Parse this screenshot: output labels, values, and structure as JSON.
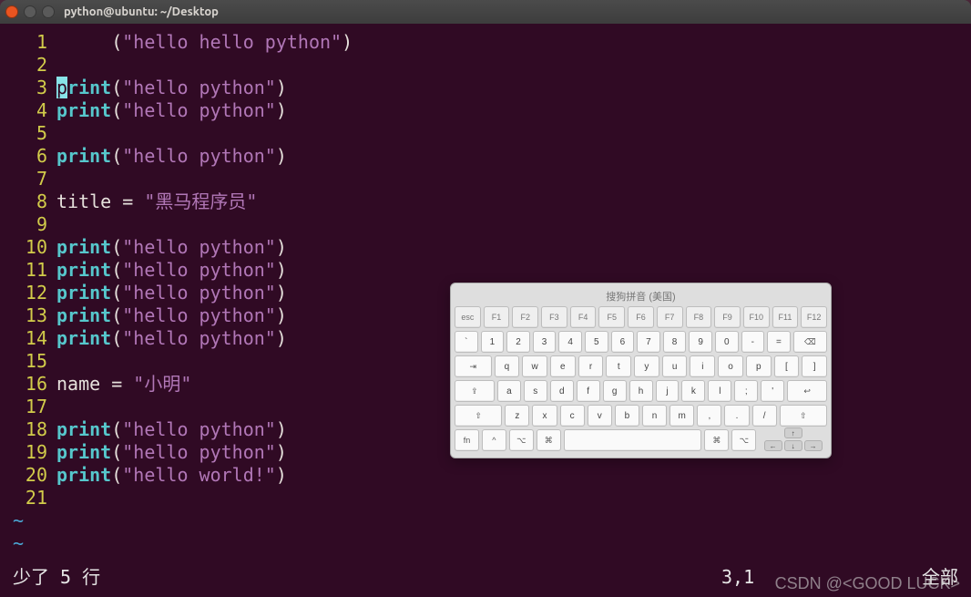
{
  "window": {
    "title": "python@ubuntu: ~/Desktop"
  },
  "cursor": {
    "row": 3,
    "col": 1,
    "char": "p"
  },
  "code_lines": [
    {
      "n": 1,
      "tokens": [
        {
          "t": "plain",
          "v": "     ("
        },
        {
          "t": "str",
          "v": "\"hello hello python\""
        },
        {
          "t": "plain",
          "v": ")"
        }
      ]
    },
    {
      "n": 2,
      "tokens": []
    },
    {
      "n": 3,
      "tokens": [
        {
          "t": "cursor",
          "v": "p"
        },
        {
          "t": "kw",
          "v": "rint"
        },
        {
          "t": "plain",
          "v": "("
        },
        {
          "t": "str",
          "v": "\"hello python\""
        },
        {
          "t": "plain",
          "v": ")"
        }
      ]
    },
    {
      "n": 4,
      "tokens": [
        {
          "t": "kw",
          "v": "print"
        },
        {
          "t": "plain",
          "v": "("
        },
        {
          "t": "str",
          "v": "\"hello python\""
        },
        {
          "t": "plain",
          "v": ")"
        }
      ]
    },
    {
      "n": 5,
      "tokens": []
    },
    {
      "n": 6,
      "tokens": [
        {
          "t": "kw",
          "v": "print"
        },
        {
          "t": "plain",
          "v": "("
        },
        {
          "t": "str",
          "v": "\"hello python\""
        },
        {
          "t": "plain",
          "v": ")"
        }
      ]
    },
    {
      "n": 7,
      "tokens": []
    },
    {
      "n": 8,
      "tokens": [
        {
          "t": "plain",
          "v": "title = "
        },
        {
          "t": "str",
          "v": "\"黑马程序员\""
        }
      ]
    },
    {
      "n": 9,
      "tokens": []
    },
    {
      "n": 10,
      "tokens": [
        {
          "t": "kw",
          "v": "print"
        },
        {
          "t": "plain",
          "v": "("
        },
        {
          "t": "str",
          "v": "\"hello python\""
        },
        {
          "t": "plain",
          "v": ")"
        }
      ]
    },
    {
      "n": 11,
      "tokens": [
        {
          "t": "kw",
          "v": "print"
        },
        {
          "t": "plain",
          "v": "("
        },
        {
          "t": "str",
          "v": "\"hello python\""
        },
        {
          "t": "plain",
          "v": ")"
        }
      ]
    },
    {
      "n": 12,
      "tokens": [
        {
          "t": "kw",
          "v": "print"
        },
        {
          "t": "plain",
          "v": "("
        },
        {
          "t": "str",
          "v": "\"hello python\""
        },
        {
          "t": "plain",
          "v": ")"
        }
      ]
    },
    {
      "n": 13,
      "tokens": [
        {
          "t": "kw",
          "v": "print"
        },
        {
          "t": "plain",
          "v": "("
        },
        {
          "t": "str",
          "v": "\"hello python\""
        },
        {
          "t": "plain",
          "v": ")"
        }
      ]
    },
    {
      "n": 14,
      "tokens": [
        {
          "t": "kw",
          "v": "print"
        },
        {
          "t": "plain",
          "v": "("
        },
        {
          "t": "str",
          "v": "\"hello python\""
        },
        {
          "t": "plain",
          "v": ")"
        }
      ]
    },
    {
      "n": 15,
      "tokens": []
    },
    {
      "n": 16,
      "tokens": [
        {
          "t": "plain",
          "v": "name = "
        },
        {
          "t": "str",
          "v": "\"小明\""
        }
      ]
    },
    {
      "n": 17,
      "tokens": []
    },
    {
      "n": 18,
      "tokens": [
        {
          "t": "kw",
          "v": "print"
        },
        {
          "t": "plain",
          "v": "("
        },
        {
          "t": "str",
          "v": "\"hello python\""
        },
        {
          "t": "plain",
          "v": ")"
        }
      ]
    },
    {
      "n": 19,
      "tokens": [
        {
          "t": "kw",
          "v": "print"
        },
        {
          "t": "plain",
          "v": "("
        },
        {
          "t": "str",
          "v": "\"hello python\""
        },
        {
          "t": "plain",
          "v": ")"
        }
      ]
    },
    {
      "n": 20,
      "tokens": [
        {
          "t": "kw",
          "v": "print"
        },
        {
          "t": "plain",
          "v": "("
        },
        {
          "t": "str",
          "v": "\"hello world!\""
        },
        {
          "t": "plain",
          "v": ")"
        }
      ]
    },
    {
      "n": 21,
      "tokens": []
    }
  ],
  "eof_tilde": "~",
  "status": {
    "message": "少了 5 行",
    "position": "3,1",
    "percent": "全部"
  },
  "watermark": "CSDN @<GOOD LUCK>",
  "osk": {
    "title": "搜狗拼音 (美国)",
    "row_fn": [
      "esc",
      "F1",
      "F2",
      "F3",
      "F4",
      "F5",
      "F6",
      "F7",
      "F8",
      "F9",
      "F10",
      "F11",
      "F12"
    ],
    "row_num": [
      "`",
      "1",
      "2",
      "3",
      "4",
      "5",
      "6",
      "7",
      "8",
      "9",
      "0",
      "-",
      "="
    ],
    "row_num_bksp": "⌫",
    "row_q": [
      "q",
      "w",
      "e",
      "r",
      "t",
      "y",
      "u",
      "i",
      "o",
      "p",
      "[",
      "]"
    ],
    "row_q_tab": "⇥",
    "row_a": [
      "a",
      "s",
      "d",
      "f",
      "g",
      "h",
      "j",
      "k",
      "l",
      ";",
      "'"
    ],
    "row_a_caps": "⇪",
    "row_a_enter": "↩",
    "row_z": [
      "z",
      "x",
      "c",
      "v",
      "b",
      "n",
      "m",
      ",",
      ".",
      "/"
    ],
    "row_z_shiftL": "⇧",
    "row_z_shiftR": "⇧",
    "row_bot": {
      "fn": "fn",
      "ctrl": "^",
      "optL": "⌥",
      "cmdL": "⌘",
      "space": "",
      "cmdR": "⌘",
      "optR": "⌥"
    },
    "arrows": {
      "up": "↑",
      "left": "←",
      "down": "↓",
      "right": "→"
    }
  }
}
